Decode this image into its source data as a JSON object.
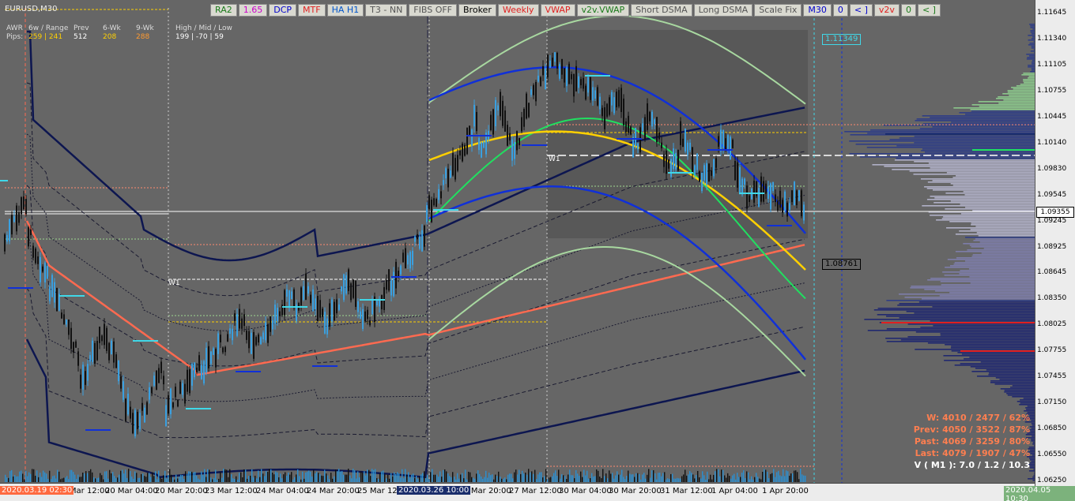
{
  "window": {
    "title": "EURUSD,M30"
  },
  "toolbar": {
    "buttons": [
      {
        "label": "RA2",
        "color": "#1a7a1a"
      },
      {
        "label": "1.65",
        "color": "#cc00cc"
      },
      {
        "label": "DCP",
        "color": "#0000cc"
      },
      {
        "label": "MTF",
        "color": "#e02020"
      },
      {
        "label": "HA H1",
        "color": "#0055cc"
      },
      {
        "label": "T3 - NN",
        "color": "#555555"
      },
      {
        "label": "FIBS OFF",
        "color": "#555555"
      },
      {
        "label": "Broker",
        "color": "#000000"
      },
      {
        "label": "Weekly",
        "color": "#e02020"
      },
      {
        "label": "VWAP",
        "color": "#e02020"
      },
      {
        "label": "v2v.VWAP",
        "color": "#1a7a1a"
      },
      {
        "label": "Short DSMA",
        "color": "#555555"
      },
      {
        "label": "Long DSMA",
        "color": "#555555"
      },
      {
        "label": "Scale Fix",
        "color": "#555555"
      },
      {
        "label": "M30",
        "color": "#0000cc"
      },
      {
        "label": "0",
        "color": "#0000cc"
      },
      {
        "label": "< ]",
        "color": "#0000cc"
      },
      {
        "label": "v2v",
        "color": "#e02020"
      },
      {
        "label": "0",
        "color": "#1a7a1a"
      },
      {
        "label": "< ]",
        "color": "#1a7a1a"
      }
    ]
  },
  "stats": {
    "row1": {
      "a": "AWR",
      "b": "6w / Range",
      "c": "Prev",
      "d": "6-Wk",
      "e": "9-Wk",
      "f": "High / Mid / Low"
    },
    "row2": {
      "a": "Pips:",
      "b": "259 | 241",
      "c": "512",
      "d": "208",
      "e": "288",
      "f": "199  |  -70  |  59"
    }
  },
  "price_axis": {
    "ticks": [
      "1.11645",
      "1.11340",
      "1.11105",
      "1.10755",
      "1.10445",
      "1.10140",
      "1.09830",
      "1.09545",
      "1.09245",
      "1.08925",
      "1.08645",
      "1.08350",
      "1.08025",
      "1.07755",
      "1.07455",
      "1.07150",
      "1.06850",
      "1.06550",
      "1.06250"
    ],
    "current": "1.09355",
    "label_high": "1.11349",
    "label_low": "1.08761"
  },
  "time_axis": {
    "start_label": "2020.03.19 02:30",
    "mid_label": "2020.03.26 10:00",
    "end_label": "2020.04.05 10:30",
    "labels": [
      "19 Mar 12:00",
      "20 Mar 04:00",
      "20 Mar 20:00",
      "23 Mar 12:00",
      "24 Mar 04:00",
      "24 Mar 20:00",
      "25 Mar 12:00",
      "26 Mar 20:00",
      "27 Mar 12:00",
      "30 Mar 04:00",
      "30 Mar 20:00",
      "31 Mar 12:00",
      "1 Apr 04:00",
      "1 Apr 20:00"
    ]
  },
  "markers": {
    "w1_left": "W1",
    "w1_right": "W1"
  },
  "info": {
    "w": "W: 4010 / 2477 / 62%",
    "prev": "Prev: 4050 / 3522 / 87%",
    "past": "Past: 4069 / 3259 / 80%",
    "last": "Last: 4079 / 1907 / 47%",
    "v": "V ( M1 ): 7.0 / 1.2 / 10.3"
  },
  "colors": {
    "background": "#666666",
    "candle_up": "#3aa0e0",
    "candle_down": "#111111",
    "vwap": "#ff6a50",
    "navy_band": "#0d1650",
    "blue_arc": "#1030d8",
    "yellow_arc": "#ffd000",
    "green_line": "#20e060",
    "light_green": "#a8d8a0"
  }
}
